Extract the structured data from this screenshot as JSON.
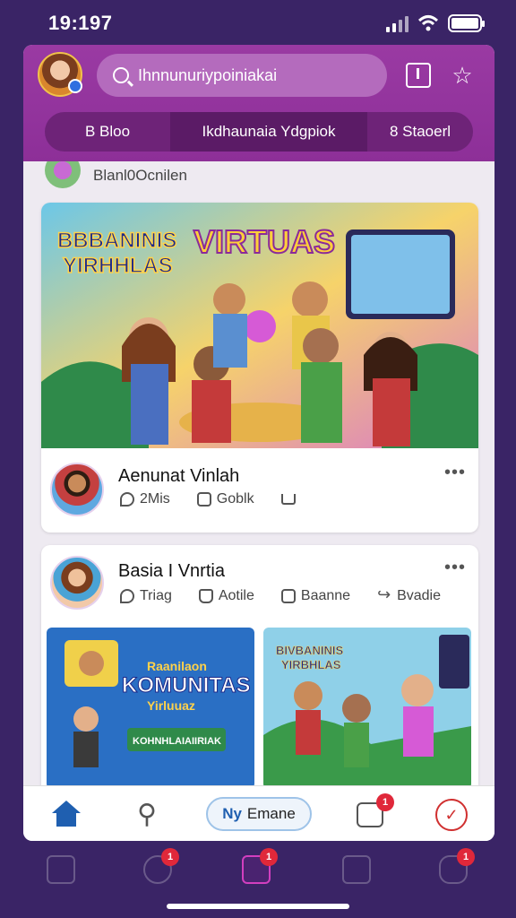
{
  "status_bar": {
    "time": "19:197"
  },
  "header": {
    "search_placeholder": "Ihnnunuriypoiniakai",
    "tabs": [
      {
        "label": "B Bloo"
      },
      {
        "label": "Ikdhaunaia Ydgpiok"
      },
      {
        "label": "8 Staoerl"
      }
    ]
  },
  "feed": {
    "mini_row_label": "Blanl0Ocnilen",
    "hero_banner": {
      "title_left_line1": "BBBANINIS",
      "title_left_line2": "YIRHHLAS",
      "title_right": "VIRTUAS"
    },
    "posts": [
      {
        "author": "Aenunat Vinlah",
        "actions": [
          {
            "label": "2Mis",
            "icon": "comment-icon"
          },
          {
            "label": "Goblk",
            "icon": "chat-icon"
          },
          {
            "label": "",
            "icon": "share-icon"
          }
        ]
      },
      {
        "author": "Basia I Vnrtia",
        "actions": [
          {
            "label": "Triag",
            "icon": "comment-icon"
          },
          {
            "label": "Aotile",
            "icon": "like-icon"
          },
          {
            "label": "Baanne",
            "icon": "chat-icon"
          },
          {
            "label": "Bvadie",
            "icon": "arrow-share-icon"
          }
        ],
        "thumbnails": [
          {
            "line1": "Raanilaon",
            "line2": "KOMUNITAS",
            "line3": "Yirluuaz",
            "caption": "KOHNHLAIAIIRIAK"
          },
          {
            "line1": "BIVBANINIS",
            "line2": "YIRBHLAS"
          }
        ]
      }
    ]
  },
  "bottom_nav": {
    "pill_prefix": "Ny",
    "pill_label": "Emane",
    "inbox_badge": "1"
  },
  "dock": {
    "badges": [
      "1",
      "1",
      "1"
    ]
  },
  "colors": {
    "header": "#9a3aa3",
    "background": "#3a2466",
    "accent": "#1f5fb0",
    "badge": "#e0283a"
  }
}
